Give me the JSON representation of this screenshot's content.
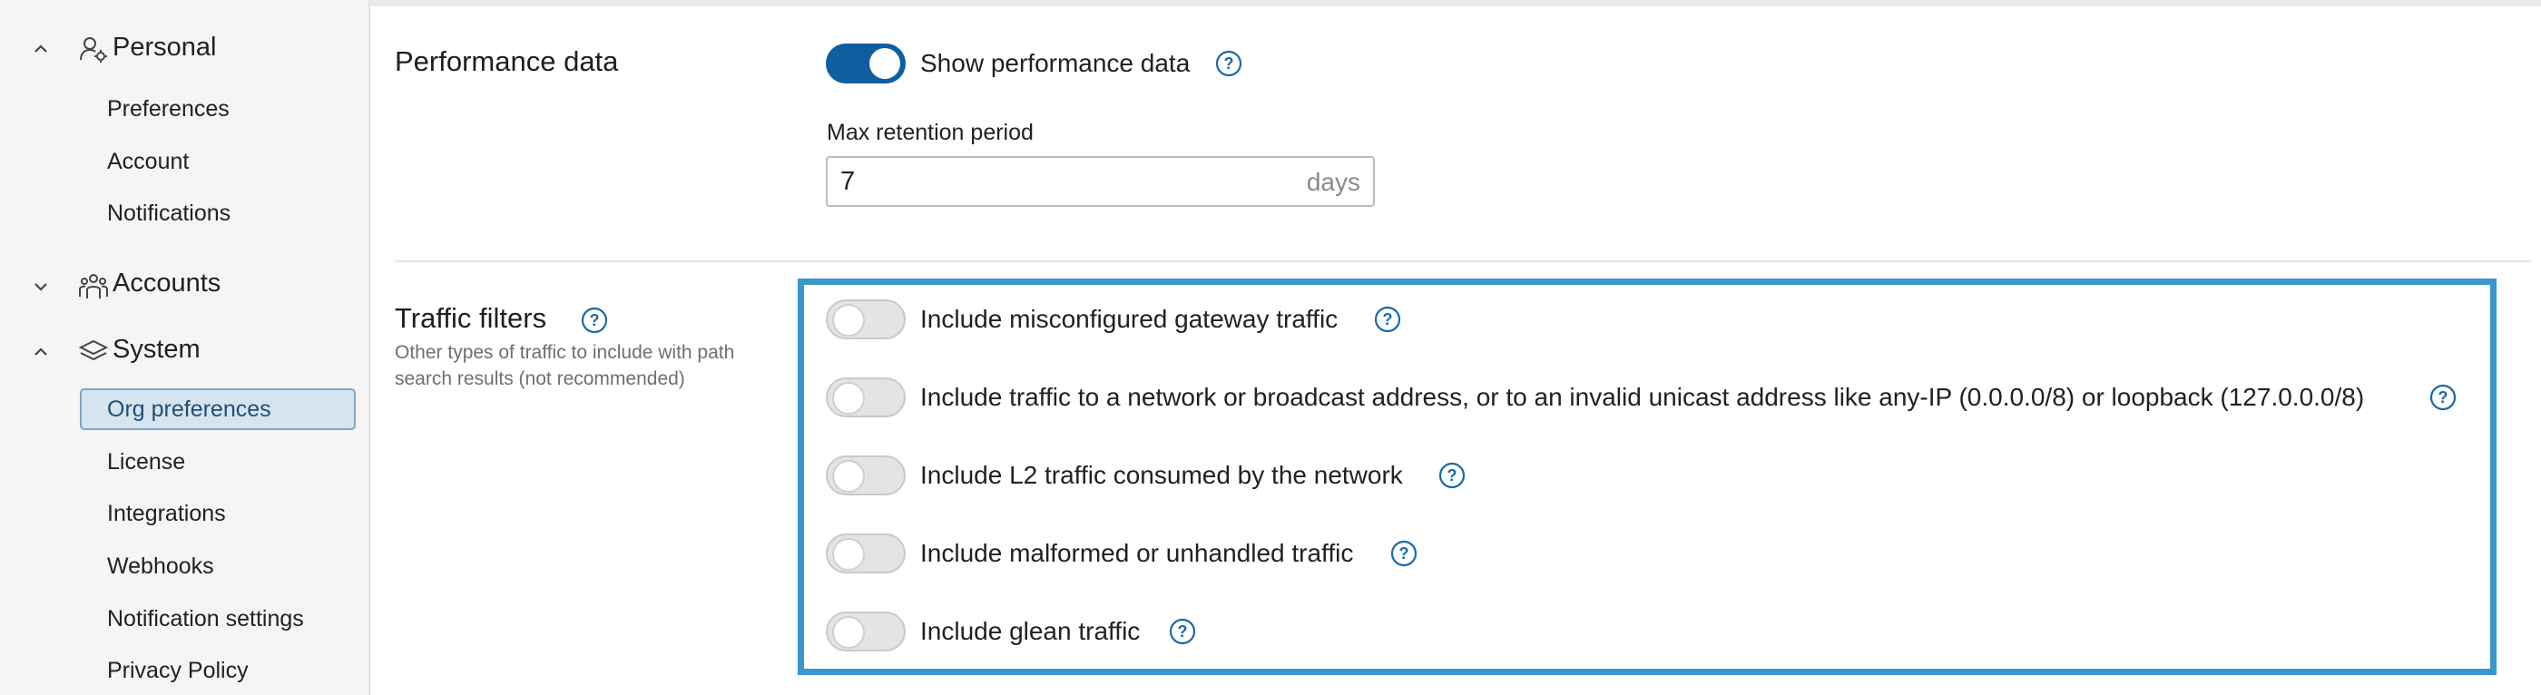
{
  "sidebar": {
    "personal": {
      "label": "Personal",
      "expanded": true,
      "icon": "user-gear-icon"
    },
    "personal_items": [
      "Preferences",
      "Account",
      "Notifications"
    ],
    "accounts": {
      "label": "Accounts",
      "expanded": false,
      "icon": "people-icon"
    },
    "system": {
      "label": "System",
      "expanded": true,
      "icon": "layers-icon"
    },
    "system_items": [
      "Org preferences",
      "License",
      "Integrations",
      "Webhooks",
      "Notification settings",
      "Privacy Policy"
    ],
    "active_item": "Org preferences"
  },
  "performance": {
    "title": "Performance data",
    "toggle_label": "Show performance data",
    "toggle_on": true,
    "retention_label": "Max retention period",
    "retention_value": "7",
    "retention_unit": "days"
  },
  "traffic": {
    "title": "Traffic filters",
    "subtitle": "Other types of traffic to include with path search results (not recommended)",
    "options": [
      {
        "label": "Include misconfigured gateway traffic",
        "on": false
      },
      {
        "label": "Include traffic to a network or broadcast address, or to an invalid unicast address like any-IP (0.0.0.0/8) or loopback (127.0.0.0/8)",
        "on": false
      },
      {
        "label": "Include L2 traffic consumed by the network",
        "on": false
      },
      {
        "label": "Include malformed or unhandled traffic",
        "on": false
      },
      {
        "label": "Include glean traffic",
        "on": false
      }
    ]
  },
  "colors": {
    "accent": "#0f5ea0",
    "highlight": "#3a97cb",
    "help": "#1a6aa8"
  }
}
